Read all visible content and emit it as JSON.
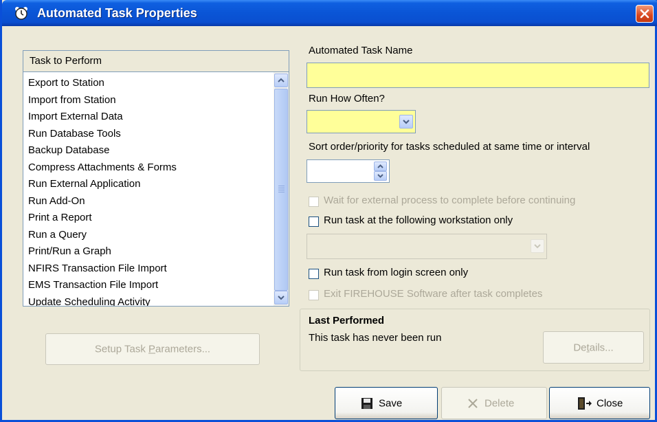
{
  "window": {
    "title": "Automated Task Properties",
    "title_icon": "alarm-clock-icon",
    "close_icon": "close-icon"
  },
  "task_list": {
    "header": "Task to Perform",
    "items": [
      "Export to Station",
      "Import from Station",
      "Import External Data",
      "Run Database Tools",
      "Backup Database",
      "Compress Attachments & Forms",
      "Run External Application",
      "Run Add-On",
      "Print a Report",
      "Run a Query",
      "Print/Run a Graph",
      "NFIRS Transaction File Import",
      "EMS Transaction File Import",
      "Update Scheduling Activity"
    ]
  },
  "form": {
    "name_label": "Automated Task Name",
    "name_value": "",
    "how_often_label": "Run How Often?",
    "how_often_value": "",
    "sort_label": "Sort order/priority for tasks scheduled at same time or interval",
    "sort_value": "",
    "wait_label": "Wait for external process to complete before continuing",
    "workstation_label": "Run task at the following workstation only",
    "workstation_value": "",
    "login_label": "Run task from login screen only",
    "exit_label": "Exit FIREHOUSE Software after task completes"
  },
  "last_performed": {
    "heading": "Last Performed",
    "status": "This task has never been run",
    "details_pre": "De",
    "details_key": "t",
    "details_post": "ails..."
  },
  "buttons": {
    "setup_pre": "Setup Task ",
    "setup_key": "P",
    "setup_post": "arameters...",
    "save": "Save",
    "delete": "Delete",
    "close": "Close"
  },
  "colors": {
    "required_field": "#ffff99",
    "title_bar": "#0a55d6"
  }
}
